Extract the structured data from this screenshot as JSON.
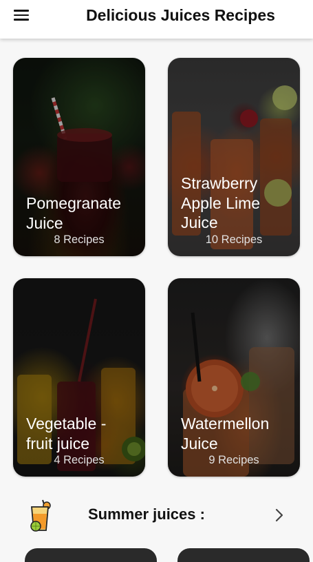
{
  "app": {
    "title": "Delicious Juices Recipes",
    "menu_icon": "hamburger-menu-icon"
  },
  "categories": [
    {
      "title_lines": [
        "Pomegranate",
        "Juice"
      ],
      "count_label": "8 Recipes"
    },
    {
      "title_lines": [
        "Strawberry",
        "Apple Lime",
        "Juice"
      ],
      "count_label": "10 Recipes"
    },
    {
      "title_lines": [
        "Vegetable -",
        "fruit juice"
      ],
      "count_label": "4 Recipes"
    },
    {
      "title_lines": [
        "Watermellon",
        "Juice"
      ],
      "count_label": "9 Recipes"
    }
  ],
  "section": {
    "title": "Summer juices :",
    "icon": "juice-glass-icon",
    "chevron_icon": "chevron-right-icon"
  },
  "colors": {
    "appbar": "#ffffff",
    "background": "#f7f7f7",
    "text_dark": "#111111",
    "card_text": "#ffffff"
  }
}
